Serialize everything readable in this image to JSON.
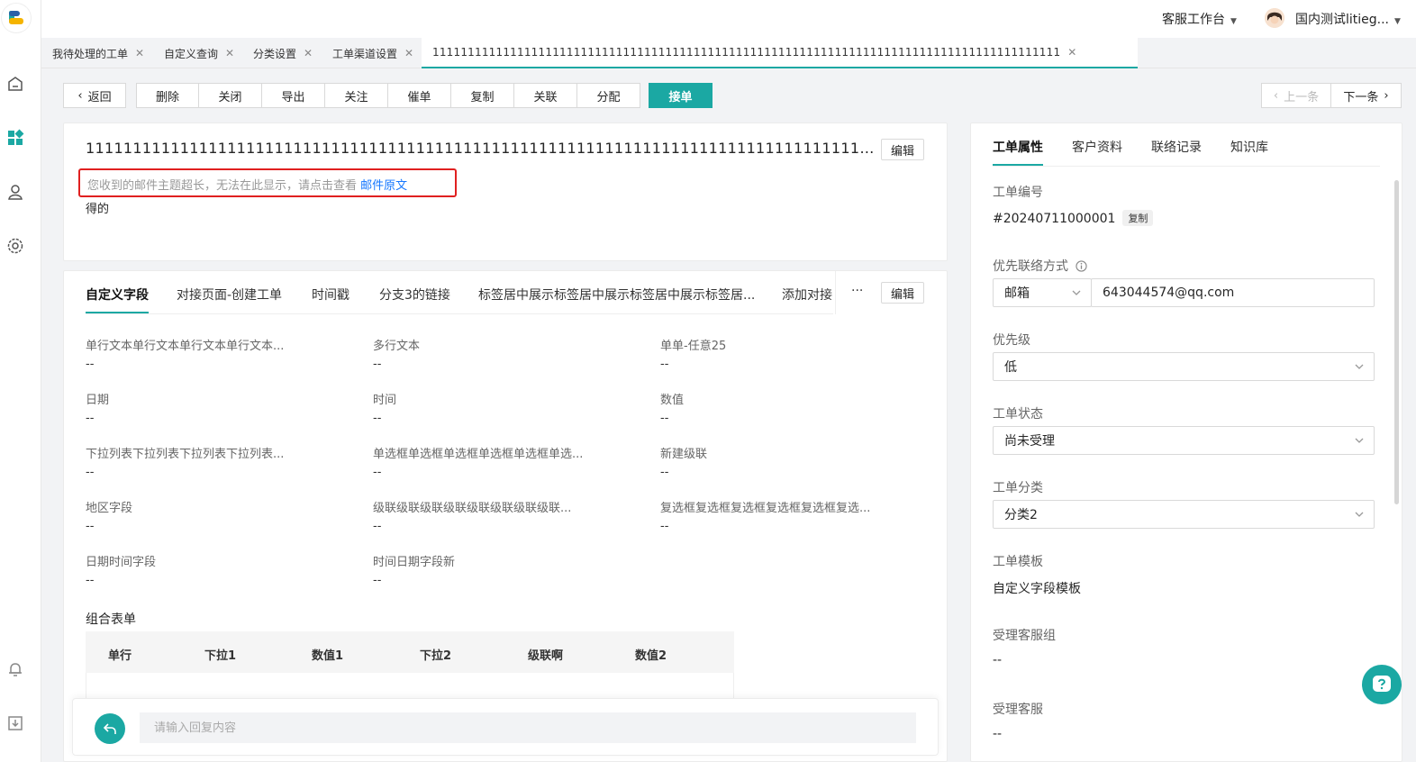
{
  "colors": {
    "accent": "#1ba8a3",
    "link": "#1677ff",
    "warning_border": "#e02020"
  },
  "topbar": {
    "workspace": "客服工作台",
    "username": "国内测试litieg..."
  },
  "page_tabs": [
    {
      "label": "我待处理的工单"
    },
    {
      "label": "自定义查询"
    },
    {
      "label": "分类设置"
    },
    {
      "label": "工单渠道设置"
    },
    {
      "label": "11111111111111111111111111111111111111111111111111111111111111111111111111111111111111111"
    }
  ],
  "toolbar": {
    "back": "返回",
    "delete": "删除",
    "close": "关闭",
    "export": "导出",
    "follow": "关注",
    "urge": "催单",
    "copy": "复制",
    "relate": "关联",
    "assign": "分配",
    "accept": "接单",
    "prev": "上一条",
    "next": "下一条"
  },
  "ticket": {
    "subject": "1111111111111111111111111111111111111111111111111111111111111111111111111111111111111111111111",
    "edit": "编辑",
    "warning_text": "您收到的邮件主题超长，无法在此显示，请点击查看",
    "warning_link": "邮件原文",
    "body": "得的"
  },
  "detail": {
    "tabs": [
      "自定义字段",
      "对接页面-创建工单",
      "时间戳",
      "分支3的链接",
      "标签居中展示标签居中展示标签居中展示标签居...",
      "添加对接页面"
    ],
    "more": "···",
    "edit": "编辑",
    "fields": [
      {
        "label": "单行文本单行文本单行文本单行文本...",
        "value": "--"
      },
      {
        "label": "多行文本",
        "value": "--"
      },
      {
        "label": "单单-任意25",
        "value": "--"
      },
      {
        "label": "日期",
        "value": "--"
      },
      {
        "label": "时间",
        "value": "--"
      },
      {
        "label": "数值",
        "value": "--"
      },
      {
        "label": "下拉列表下拉列表下拉列表下拉列表...",
        "value": "--"
      },
      {
        "label": "单选框单选框单选框单选框单选框单选...",
        "value": "--"
      },
      {
        "label": "新建级联",
        "value": "--"
      },
      {
        "label": "地区字段",
        "value": "--"
      },
      {
        "label": "级联级联级联级联级联级联级联级联...",
        "value": "--"
      },
      {
        "label": "复选框复选框复选框复选框复选框复选...",
        "value": "--"
      },
      {
        "label": "日期时间字段",
        "value": "--"
      },
      {
        "label": "时间日期字段新",
        "value": "--"
      }
    ],
    "group_title": "组合表单",
    "table_headers": [
      "单行",
      "下拉1",
      "数值1",
      "下拉2",
      "级联啊",
      "数值2"
    ]
  },
  "reply": {
    "placeholder": "请输入回复内容"
  },
  "right": {
    "tabs": [
      "工单属性",
      "客户资料",
      "联络记录",
      "知识库"
    ],
    "ticket_no_label": "工单编号",
    "ticket_no": "#20240711000001",
    "copy": "复制",
    "contact_label": "优先联络方式",
    "contact_type": "邮箱",
    "contact_value": "643044574@qq.com",
    "priority_label": "优先级",
    "priority": "低",
    "status_label": "工单状态",
    "status": "尚未受理",
    "category_label": "工单分类",
    "category": "分类2",
    "template_label": "工单模板",
    "template": "自定义字段模板",
    "group_label": "受理客服组",
    "group": "--",
    "agent_label": "受理客服",
    "agent": "--"
  }
}
